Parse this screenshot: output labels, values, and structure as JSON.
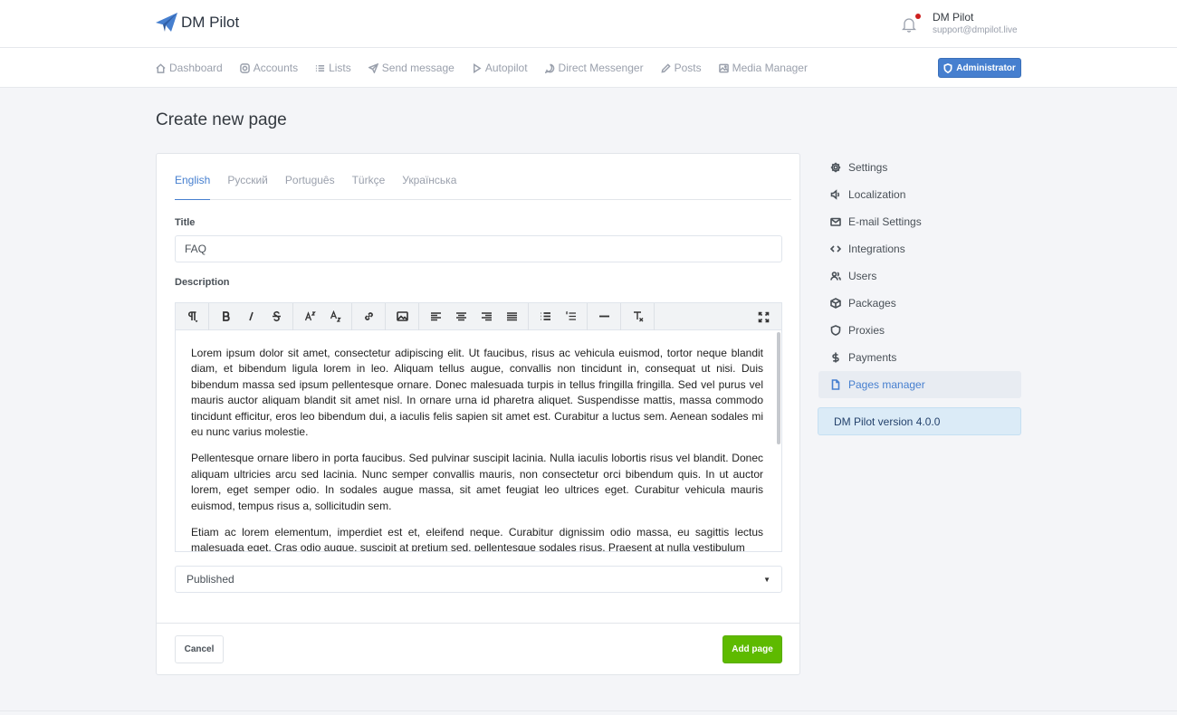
{
  "header": {
    "brand": "DM Pilot",
    "user_name": "DM Pilot",
    "user_email": "support@dmpilot.live"
  },
  "nav": {
    "items": [
      {
        "label": "Dashboard",
        "icon": "home-icon"
      },
      {
        "label": "Accounts",
        "icon": "instagram-icon"
      },
      {
        "label": "Lists",
        "icon": "list-icon"
      },
      {
        "label": "Send message",
        "icon": "send-icon"
      },
      {
        "label": "Autopilot",
        "icon": "play-icon"
      },
      {
        "label": "Direct Messenger",
        "icon": "message-icon"
      },
      {
        "label": "Posts",
        "icon": "edit-icon"
      },
      {
        "label": "Media Manager",
        "icon": "image-icon"
      }
    ],
    "admin_label": "Administrator"
  },
  "page": {
    "title": "Create new page"
  },
  "form": {
    "tabs": [
      {
        "label": "English",
        "active": true
      },
      {
        "label": "Русский",
        "active": false
      },
      {
        "label": "Português",
        "active": false
      },
      {
        "label": "Türkçe",
        "active": false
      },
      {
        "label": "Українська",
        "active": false
      }
    ],
    "title_label": "Title",
    "title_value": "FAQ",
    "description_label": "Description",
    "status_value": "Published",
    "cancel_label": "Cancel",
    "submit_label": "Add page"
  },
  "editor": {
    "paragraphs": [
      "Lorem ipsum dolor sit amet, consectetur adipiscing elit. Ut faucibus, risus ac vehicula euismod, tortor neque blandit diam, et bibendum ligula lorem in leo. Aliquam tellus augue, convallis non tincidunt in, consequat ut nisi. Duis bibendum massa sed ipsum pellentesque ornare. Donec malesuada turpis in tellus fringilla fringilla. Sed vel purus vel mauris auctor aliquam blandit sit amet nisl. In ornare urna id pharetra aliquet. Suspendisse mattis, massa commodo tincidunt efficitur, eros leo bibendum dui, a iaculis felis sapien sit amet est. Curabitur a luctus sem. Aenean sodales mi eu nunc varius molestie.",
      "Pellentesque ornare libero in porta faucibus. Sed pulvinar suscipit lacinia. Nulla iaculis lobortis risus vel blandit. Donec aliquam ultricies arcu sed lacinia. Nunc semper convallis mauris, non consectetur orci bibendum quis. In ut auctor lorem, eget semper odio. In sodales augue massa, sit amet feugiat leo ultrices eget. Curabitur vehicula mauris euismod, tempus risus a, sollicitudin sem.",
      "Etiam ac lorem elementum, imperdiet est et, eleifend neque. Curabitur dignissim odio massa, eu sagittis lectus malesuada eget. Cras odio augue, suscipit at pretium sed, pellentesque sodales risus. Praesent at nulla vestibulum"
    ]
  },
  "sidebar": {
    "items": [
      {
        "label": "Settings",
        "icon": "gear-icon",
        "active": false
      },
      {
        "label": "Localization",
        "icon": "speaker-icon",
        "active": false
      },
      {
        "label": "E-mail Settings",
        "icon": "mail-icon",
        "active": false
      },
      {
        "label": "Integrations",
        "icon": "code-icon",
        "active": false
      },
      {
        "label": "Users",
        "icon": "users-icon",
        "active": false
      },
      {
        "label": "Packages",
        "icon": "package-icon",
        "active": false
      },
      {
        "label": "Proxies",
        "icon": "shield-icon",
        "active": false
      },
      {
        "label": "Payments",
        "icon": "dollar-icon",
        "active": false
      },
      {
        "label": "Pages manager",
        "icon": "file-icon",
        "active": true
      }
    ],
    "version": "DM Pilot version 4.0.0"
  },
  "colors": {
    "primary": "#467fcf",
    "success": "#5eba00",
    "notification_dot": "#cd201f",
    "info_bg": "#dbebf7"
  }
}
